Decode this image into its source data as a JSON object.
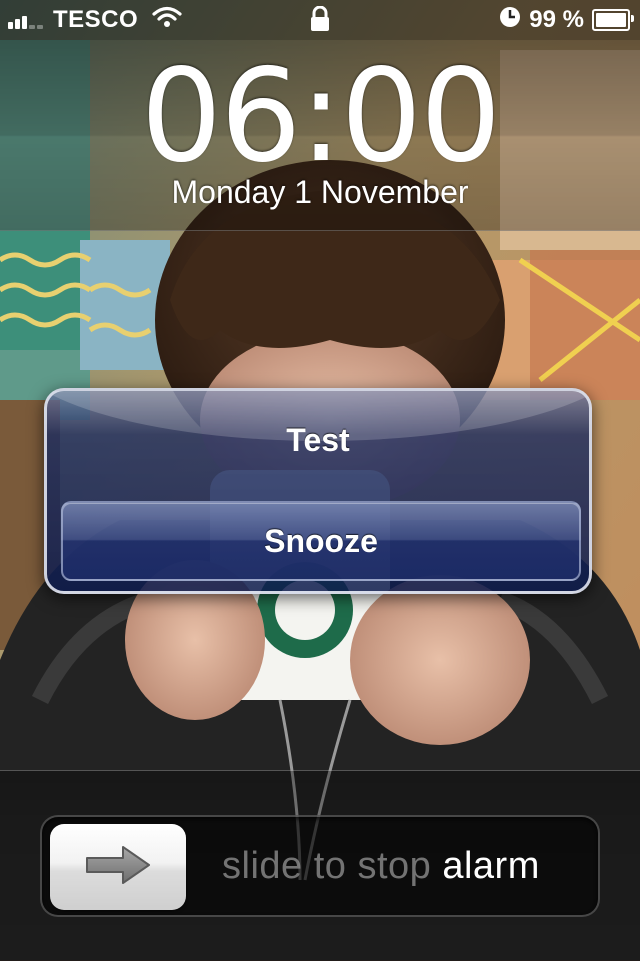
{
  "status_bar": {
    "carrier": "TESCO",
    "battery_percent": "99 %",
    "battery_level": 0.99,
    "signal_bars_active": 3,
    "signal_bars_total": 5
  },
  "lock_screen": {
    "time": "06:00",
    "date": "Monday 1 November"
  },
  "alarm": {
    "title": "Test",
    "snooze_label": "Snooze"
  },
  "slider": {
    "label_dim": "slide to stop ",
    "label_shine": "alarm",
    "arrow_icon": "right-arrow-icon"
  },
  "colors": {
    "alert_blue": "#1a2c6a",
    "status_text": "#ffffff"
  }
}
